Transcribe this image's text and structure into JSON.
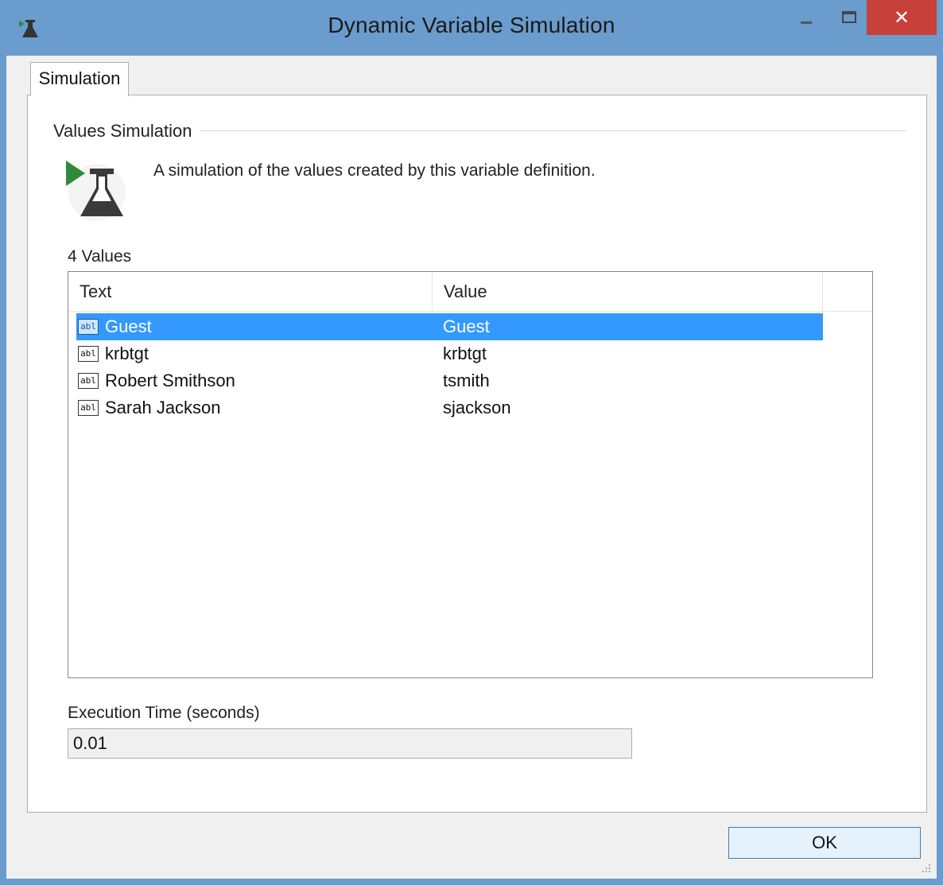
{
  "window": {
    "title": "Dynamic Variable Simulation",
    "close_glyph": "✕"
  },
  "tabs": [
    {
      "label": "Simulation"
    }
  ],
  "group": {
    "title": "Values Simulation",
    "description": "A simulation of the values created by this variable definition.",
    "icon": "flask-play-icon"
  },
  "values": {
    "count_label": "4 Values",
    "columns": [
      "Text",
      "Value"
    ],
    "row_icon_text": "abl",
    "rows": [
      {
        "text": "Guest",
        "value": "Guest",
        "selected": true
      },
      {
        "text": "krbtgt",
        "value": "krbtgt",
        "selected": false
      },
      {
        "text": "Robert Smithson",
        "value": "tsmith",
        "selected": false
      },
      {
        "text": "Sarah Jackson",
        "value": "sjackson",
        "selected": false
      }
    ]
  },
  "execution": {
    "label": "Execution Time (seconds)",
    "value": "0.01"
  },
  "buttons": {
    "ok": "OK"
  },
  "colors": {
    "titlebar": "#6a9ccd",
    "close_button": "#c7403a",
    "selection": "#3399ff",
    "play_green": "#2e8b3a"
  }
}
